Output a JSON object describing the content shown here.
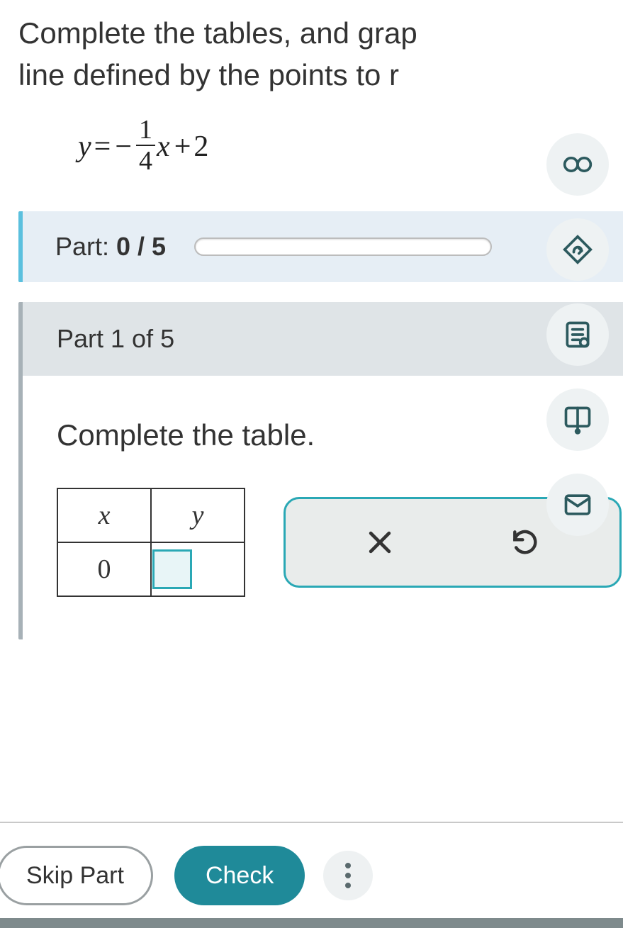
{
  "question": {
    "line1": "Complete the tables, and grap",
    "line2": "line defined by the points to r"
  },
  "equation": {
    "lhs": "y",
    "eq": "=",
    "neg": "−",
    "frac_num": "1",
    "frac_den": "4",
    "var": "x",
    "plus": "+",
    "const": "2"
  },
  "progress": {
    "prefix": "Part: ",
    "value": "0 / 5"
  },
  "part": {
    "header": "Part 1 of 5",
    "instruction": "Complete the table.",
    "table": {
      "col_x": "x",
      "col_y": "y",
      "row1_x": "0"
    }
  },
  "bottom": {
    "skip": "Skip Part",
    "check": "Check"
  }
}
